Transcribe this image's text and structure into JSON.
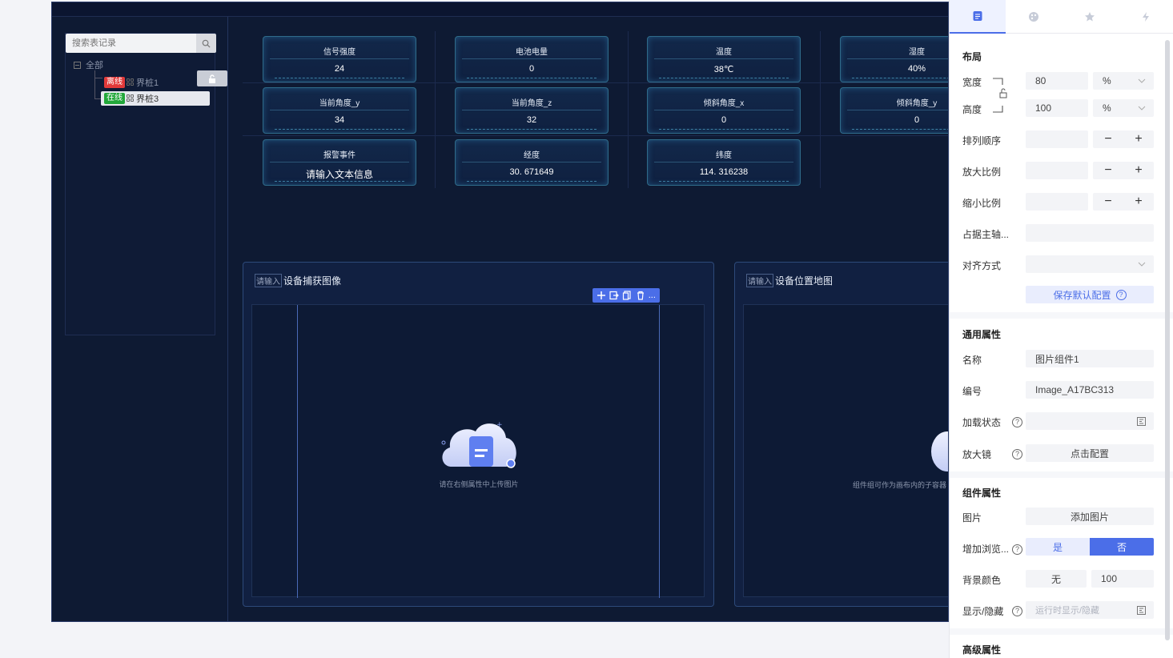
{
  "tree": {
    "search_placeholder": "搜索表记录",
    "root_label": "全部",
    "items": [
      {
        "status": "离线",
        "name": "界桩1"
      },
      {
        "status": "在线",
        "name": "界桩3"
      }
    ]
  },
  "cards": [
    {
      "label": "信号强度",
      "value": "24"
    },
    {
      "label": "电池电量",
      "value": "0"
    },
    {
      "label": "温度",
      "value": "38℃"
    },
    {
      "label": "湿度",
      "value": "40%"
    },
    {
      "label": "当前角度_y",
      "value": "34"
    },
    {
      "label": "当前角度_z",
      "value": "32"
    },
    {
      "label": "倾斜角度_x",
      "value": "0"
    },
    {
      "label": "倾斜角度_y",
      "value": "0"
    },
    {
      "label": "报警事件",
      "value": "请输入文本信息"
    },
    {
      "label": "经度",
      "value": "30. 671649"
    },
    {
      "label": "纬度",
      "value": "114. 316238"
    }
  ],
  "panels": {
    "image": {
      "title_ghost": "请输入",
      "title": "设备捕获图像",
      "hint": "请在右侧属性中上传图片"
    },
    "map": {
      "title_ghost": "请输入",
      "title": "设备位置地图",
      "hint": "组件组可作为画布内的子容器"
    }
  },
  "toolbar": {
    "more": "..."
  },
  "props": {
    "layout_title": "布局",
    "width_label": "宽度",
    "width_value": "80",
    "width_unit": "%",
    "height_label": "高度",
    "height_value": "100",
    "height_unit": "%",
    "order_label": "排列顺序",
    "grow_label": "放大比例",
    "shrink_label": "缩小比例",
    "basis_label": "占据主轴...",
    "align_label": "对齐方式",
    "save_default": "保存默认配置",
    "common_title": "通用属性",
    "name_label": "名称",
    "name_value": "图片组件1",
    "id_label": "编号",
    "id_value": "Image_A17BC313",
    "loading_label": "加载状态",
    "magnifier_label": "放大镜",
    "magnifier_btn": "点击配置",
    "component_title": "组件属性",
    "image_label": "图片",
    "add_image": "添加图片",
    "preview_label": "增加浏览...",
    "yes": "是",
    "no": "否",
    "bg_label": "背景颜色",
    "bg_value": "无",
    "bg_opacity": "100",
    "visibility_label": "显示/隐藏",
    "visibility_placeholder": "运行时显示/隐藏",
    "advanced_title": "高级属性"
  },
  "colors": {
    "accent": "#4b6ee8",
    "canvas_bg": "#0e1a33"
  }
}
